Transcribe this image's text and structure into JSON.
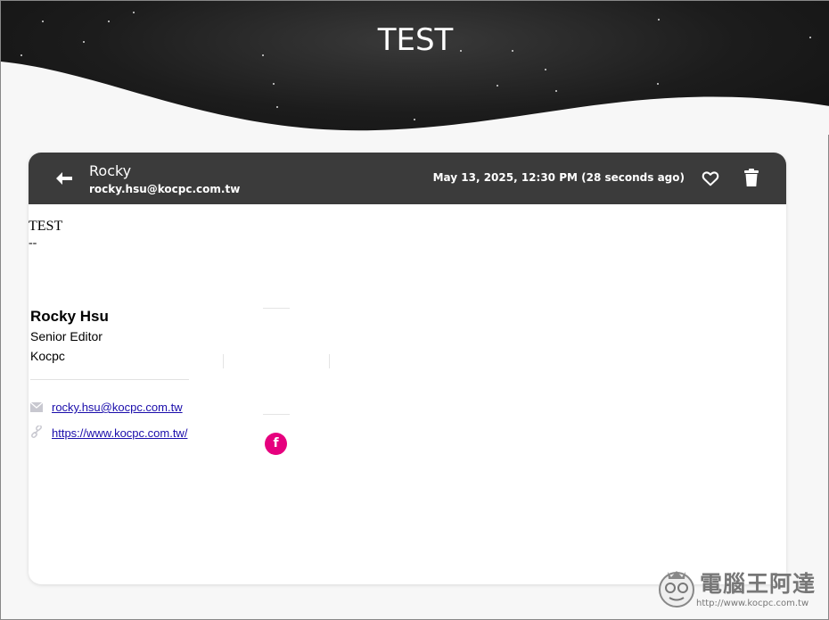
{
  "page": {
    "title": "TEST"
  },
  "header": {
    "sender_name": "Rocky",
    "sender_email": "rocky.hsu@kocpc.com.tw",
    "date": "May 13, 2025, 12:30 PM (28 seconds ago)",
    "back_icon": "arrow-left-icon",
    "favorite_icon": "heart-outline-icon",
    "delete_icon": "trash-icon"
  },
  "message": {
    "text": "TEST",
    "separator": "--"
  },
  "signature": {
    "name": "Rocky Hsu",
    "title": "Senior Editor",
    "company": "Kocpc",
    "email": "rocky.hsu@kocpc.com.tw",
    "url": "https://www.kocpc.com.tw/",
    "facebook_label": "f"
  },
  "watermark": {
    "name": "電腦王阿達",
    "url": "http://www.kocpc.com.tw"
  },
  "colors": {
    "header_bg": "#3b3b3b",
    "hero_bg": "#1c1c1c",
    "page_bg": "#f7f7f7",
    "link": "#1a0dab",
    "facebook": "#e6007e"
  }
}
